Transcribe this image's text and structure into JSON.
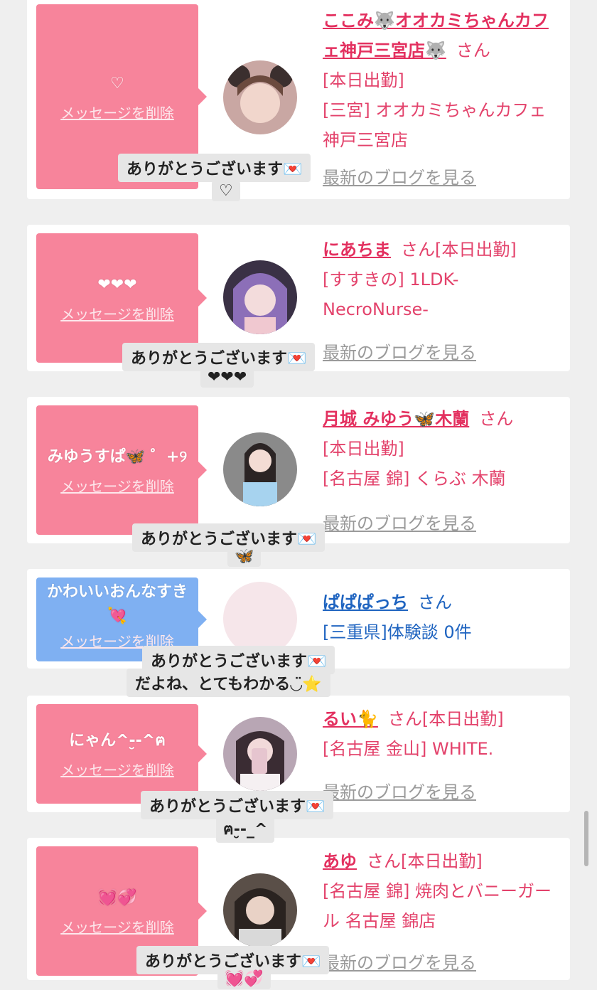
{
  "cards": [
    {
      "message": "♡",
      "delete_label": "メッセージを削除",
      "name": "ここみ🐺オオカミちゃんカフェ神戸三宮店🐺",
      "san": "さん",
      "line1": "[本日出勤]",
      "line2": "[三宮] オオカミちゃんカフェ神戸三宮店",
      "blog": "最新のブログを見る",
      "caption1": "ありがとうございます💌",
      "caption2": "♡"
    },
    {
      "message": "❤❤❤",
      "delete_label": "メッセージを削除",
      "name": "にあちま",
      "san": "さん",
      "line1": "[本日出勤]",
      "line2": "[すすきの] 1LDK-NecroNurse-",
      "blog": "最新のブログを見る",
      "caption1": "ありがとうございます💌",
      "caption2": "❤❤❤"
    },
    {
      "message": "みゆうすぱ🦋 ゜+୨",
      "delete_label": "メッセージを削除",
      "name": "月城 みゆう🦋木蘭",
      "san": "さん",
      "line1": "[本日出勤]",
      "line2": "[名古屋 錦] くらぶ 木蘭",
      "blog": "最新のブログを見る",
      "caption1": "ありがとうございます💌",
      "caption2": "🦋"
    },
    {
      "message": "かわいいおんなすき💘",
      "delete_label": "メッセージを削除",
      "name": "ぱぱぱっち",
      "san": "さん",
      "line1": "[三重県]体験談 0件",
      "caption1": "ありがとうございます💌",
      "caption2": "だよね、とてもわかる◡̈⭐"
    },
    {
      "message": "にゃん^-̮-^ฅ",
      "delete_label": "メッセージを削除",
      "name": "るい🐈",
      "san": "さん",
      "line1": "[本日出勤]",
      "line2": "[名古屋 金山] WHITE.",
      "blog": "最新のブログを見る",
      "caption1": "ありがとうございます💌",
      "caption2": "ฅ-̮-_^"
    },
    {
      "message": "💓💞",
      "delete_label": "メッセージを削除",
      "name": "あゆ",
      "san": "さん",
      "line1": "[本日出勤]",
      "line2": "[名古屋 錦] 焼肉とバニーガール 名古屋 錦店",
      "blog": "最新のブログを見る",
      "caption1": "ありがとうございます💌",
      "caption2": "💓💞"
    }
  ],
  "colors": {
    "pink_bubble": "#f7849b",
    "blue_bubble": "#7fb0f2",
    "pink_text": "#e3426b",
    "blue_text": "#1f64c0"
  }
}
